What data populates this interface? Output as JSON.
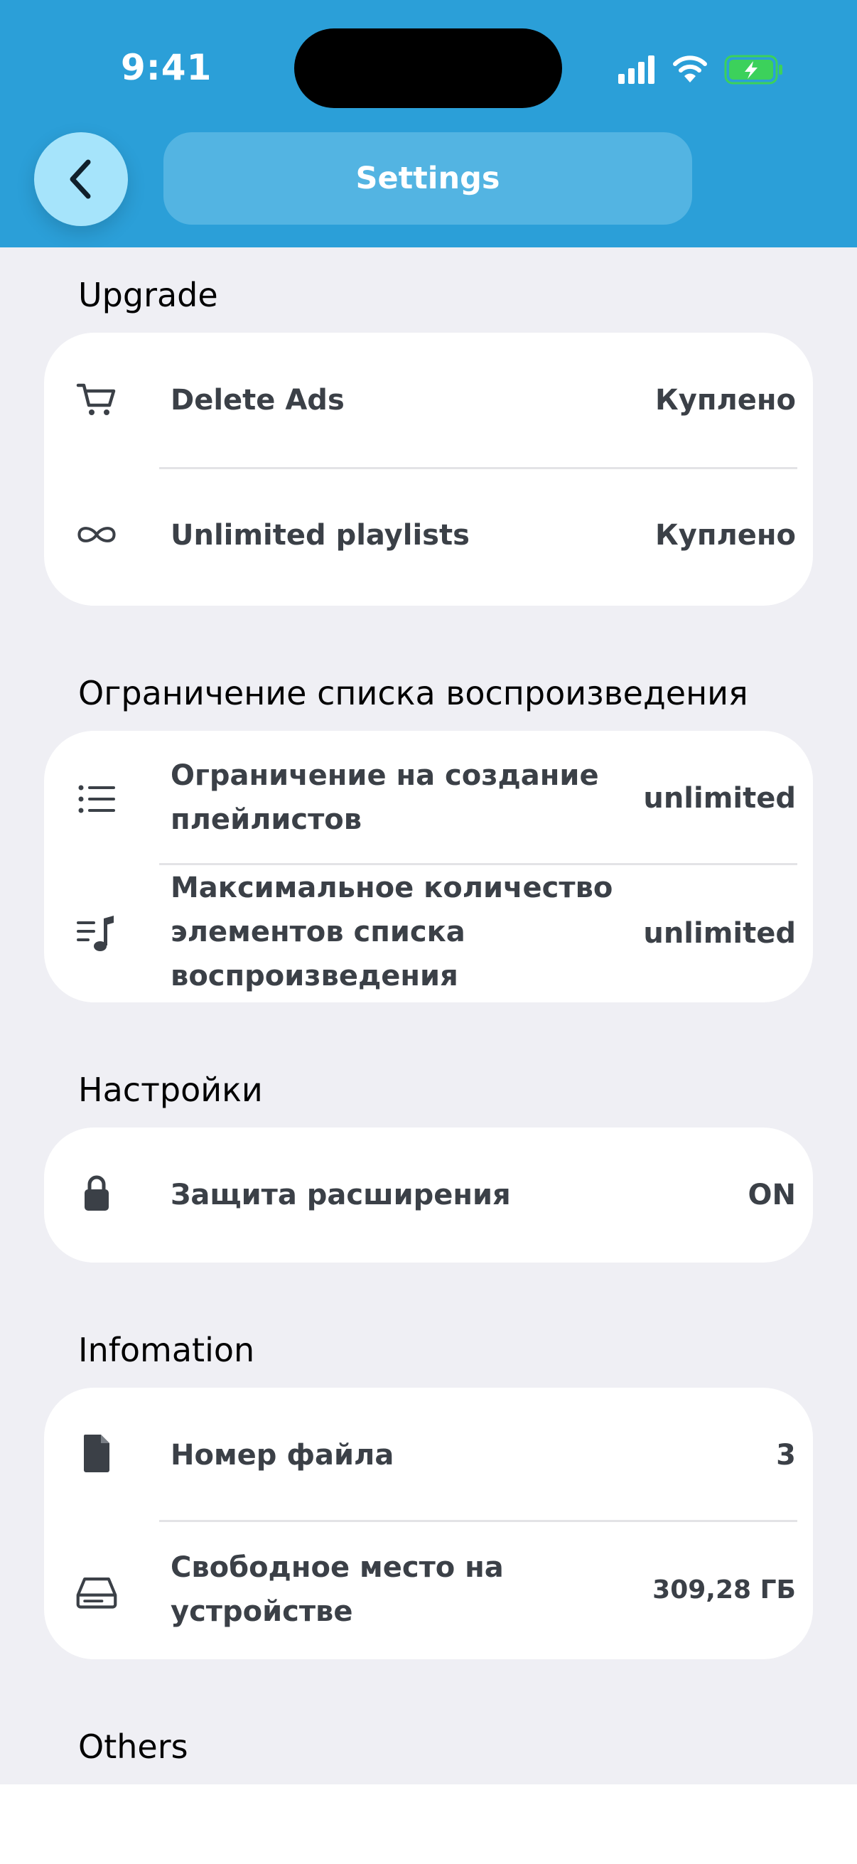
{
  "status_bar": {
    "time": "9:41"
  },
  "header": {
    "title": "Settings",
    "back_icon": "chevron-left-icon"
  },
  "colors": {
    "header_bg": "#2b9fd8",
    "back_button_bg": "#a6e4fb",
    "title_pill_bg": "#53b4e2",
    "page_bg": "#efeff4",
    "battery_green": "#3cd15b"
  },
  "sections": [
    {
      "title": "Upgrade",
      "rows": [
        {
          "icon": "cart-icon",
          "label": "Delete Ads",
          "value": "Куплено"
        },
        {
          "icon": "infinity-icon",
          "label": "Unlimited playlists",
          "value": "Куплено"
        }
      ]
    },
    {
      "title": "Ограничение списка воспроизведения",
      "rows": [
        {
          "icon": "list-icon",
          "label": "Ограничение на создание плейлистов",
          "value": "unlimited"
        },
        {
          "icon": "playlist-music-icon",
          "label": "Максимальное количество элементов списка воспроизведения",
          "value": "unlimited"
        }
      ]
    },
    {
      "title": "Настройки",
      "rows": [
        {
          "icon": "lock-icon",
          "label": "Защита расширения",
          "value": "ON"
        }
      ]
    },
    {
      "title": "Infomation",
      "rows": [
        {
          "icon": "file-icon",
          "label": "Номер файла",
          "value": "3"
        },
        {
          "icon": "storage-drive-icon",
          "label": "Свободное место на устройстве",
          "value": "309,28 ГБ"
        }
      ]
    },
    {
      "title": "Others",
      "rows": []
    }
  ]
}
